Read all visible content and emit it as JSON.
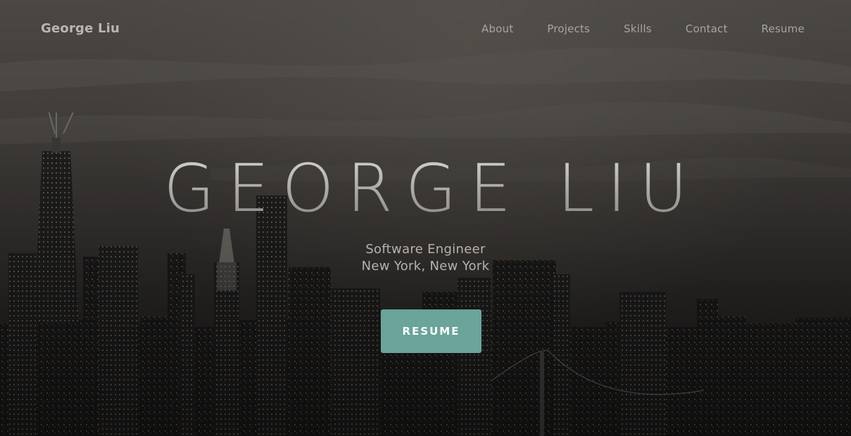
{
  "nav": {
    "brand": "George Liu",
    "links": [
      {
        "label": "About"
      },
      {
        "label": "Projects"
      },
      {
        "label": "Skills"
      },
      {
        "label": "Contact"
      },
      {
        "label": "Resume"
      }
    ]
  },
  "hero": {
    "title": "GEORGE LIU",
    "subtitle_line1": "Software Engineer",
    "subtitle_line2": "New York, New York",
    "cta_label": "RESUME",
    "background": "new-york-city-skyline-night-photo"
  },
  "colors": {
    "accent": "#6aa49b",
    "nav_text": "#a8a5a1",
    "brand_text": "#b9b6b2"
  }
}
